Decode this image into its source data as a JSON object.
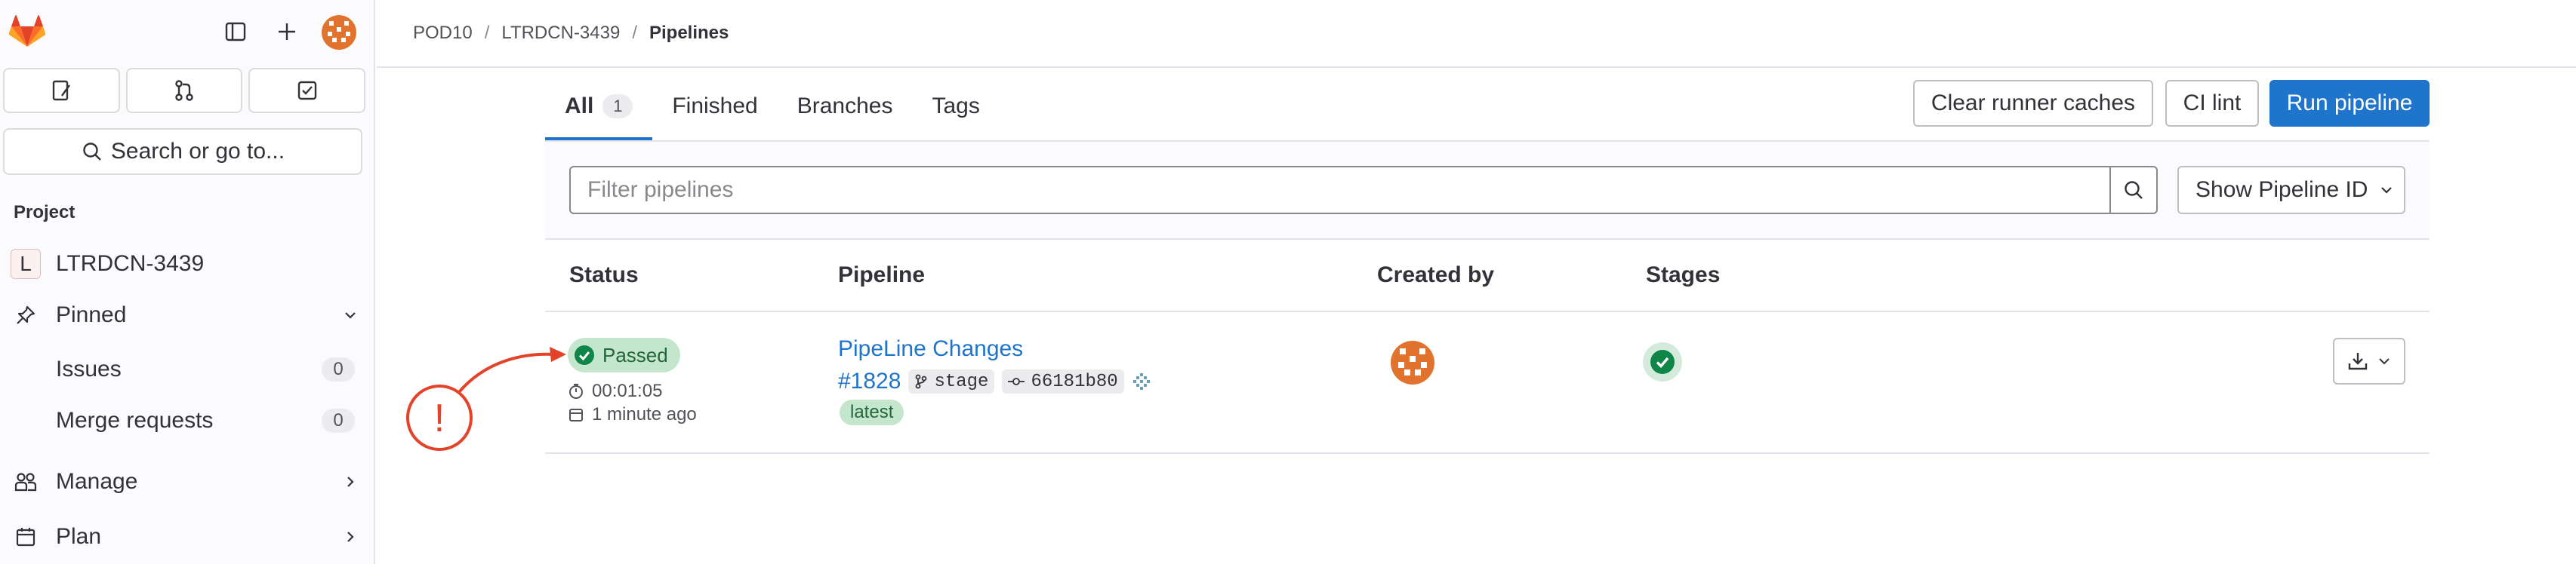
{
  "sidebar": {
    "search_label": "Search or go to...",
    "section_title": "Project",
    "project": {
      "initial": "L",
      "name": "LTRDCN-3439"
    },
    "pinned_label": "Pinned",
    "pinned_items": [
      {
        "label": "Issues",
        "count": "0"
      },
      {
        "label": "Merge requests",
        "count": "0"
      }
    ],
    "manage_label": "Manage",
    "plan_label": "Plan"
  },
  "breadcrumb": {
    "items": [
      "POD10",
      "LTRDCN-3439"
    ],
    "current": "Pipelines"
  },
  "tabs": [
    {
      "label": "All",
      "count": "1"
    },
    {
      "label": "Finished"
    },
    {
      "label": "Branches"
    },
    {
      "label": "Tags"
    }
  ],
  "actions": {
    "clear_caches": "Clear runner caches",
    "ci_lint": "CI lint",
    "run_pipeline": "Run pipeline"
  },
  "filter": {
    "placeholder": "Filter pipelines",
    "id_dropdown": "Show Pipeline ID"
  },
  "table": {
    "headers": {
      "status": "Status",
      "pipeline": "Pipeline",
      "created_by": "Created by",
      "stages": "Stages"
    },
    "rows": [
      {
        "status": "Passed",
        "duration": "00:01:05",
        "finished": "1 minute ago",
        "title": "PipeLine Changes",
        "id": "#1828",
        "ref": "stage",
        "commit": "66181b80",
        "tag": "latest"
      }
    ]
  },
  "annotation": {
    "symbol": "!"
  },
  "colors": {
    "accent": "#1f75cb",
    "success": "#108548",
    "success_bg": "#c3e6cd",
    "annotation": "#e24329",
    "avatar": "#e2732f"
  }
}
